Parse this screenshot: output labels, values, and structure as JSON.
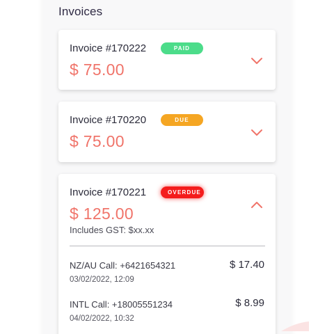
{
  "section": {
    "title": "Invoices"
  },
  "invoices": [
    {
      "title": "Invoice #170222",
      "status": "PAID",
      "amount": "$ 75.00",
      "expanded": false
    },
    {
      "title": "Invoice #170220",
      "status": "DUE",
      "amount": "$ 75.00",
      "expanded": false
    },
    {
      "title": "Invoice #170221",
      "status": "OVERDUE",
      "amount": "$ 125.00",
      "expanded": true,
      "gst": "Includes GST: $xx.xx",
      "calls": [
        {
          "label": "NZ/AU Call: +6421654321",
          "date": "03/02/2022, 12:09",
          "amount": "$ 17.40"
        },
        {
          "label": "INTL Call: +18005551234",
          "date": "04/02/2022, 10:32",
          "amount": "$ 8.99"
        }
      ]
    }
  ],
  "colors": {
    "accent": "#f0746a",
    "paid": "#4cdc8a",
    "due": "#f5a623",
    "overdue": "#f41c1c"
  },
  "icons": {
    "collapsed": "chevron-down-icon",
    "expanded": "chevron-up-icon"
  }
}
